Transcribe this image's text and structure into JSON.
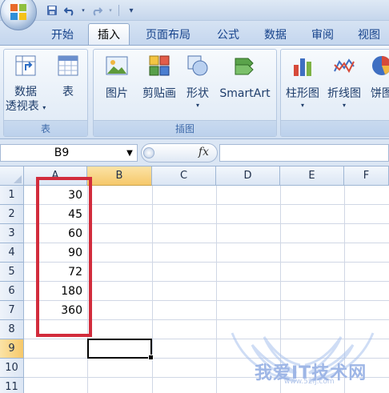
{
  "qat": {
    "save_icon": "save-icon",
    "undo_icon": "undo-icon",
    "redo_icon": "redo-icon",
    "customize_icon": "customize-qat-icon"
  },
  "tabs": [
    {
      "label": "开始"
    },
    {
      "label": "插入",
      "active": true
    },
    {
      "label": "页面布局"
    },
    {
      "label": "公式"
    },
    {
      "label": "数据"
    },
    {
      "label": "审阅"
    },
    {
      "label": "视图"
    }
  ],
  "ribbon": {
    "groups": [
      {
        "label": "表",
        "buttons": [
          {
            "label_line1": "数据",
            "label_line2": "透视表",
            "icon": "pivot-table-icon",
            "has_dropdown": true
          },
          {
            "label_line1": "表",
            "icon": "table-icon"
          }
        ]
      },
      {
        "label": "插图",
        "buttons": [
          {
            "label_line1": "图片",
            "icon": "picture-icon"
          },
          {
            "label_line1": "剪贴画",
            "icon": "clip-art-icon"
          },
          {
            "label_line1": "形状",
            "icon": "shapes-icon",
            "has_dropdown": true
          },
          {
            "label_line1": "SmartArt",
            "icon": "smartart-icon"
          }
        ]
      },
      {
        "label": "",
        "buttons": [
          {
            "label_line1": "柱形图",
            "icon": "column-chart-icon",
            "has_dropdown": true
          },
          {
            "label_line1": "折线图",
            "icon": "line-chart-icon",
            "has_dropdown": true
          },
          {
            "label_line1": "饼图",
            "icon": "pie-chart-icon"
          }
        ]
      }
    ]
  },
  "formula_bar": {
    "name_box": "B9",
    "fx_label": "fx",
    "formula": ""
  },
  "sheet": {
    "columns": [
      "A",
      "B",
      "C",
      "D",
      "E",
      "F"
    ],
    "selected_column": "B",
    "rows": [
      "1",
      "2",
      "3",
      "4",
      "5",
      "6",
      "7",
      "8",
      "9",
      "10",
      "11"
    ],
    "selected_row": "9",
    "column_a_values": [
      "30",
      "45",
      "60",
      "90",
      "72",
      "180",
      "360"
    ],
    "active_cell": "B9"
  },
  "watermark": {
    "text": "我爱IT技术网",
    "url": "www.52ij.com"
  }
}
